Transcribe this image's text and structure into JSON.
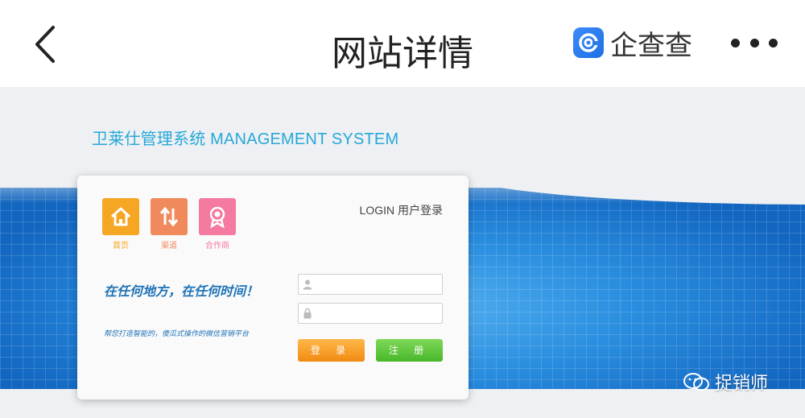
{
  "header": {
    "title": "网站详情",
    "brand_name": "企查查",
    "brand_color": "#2b7de9"
  },
  "website": {
    "system_title": "卫莱仕管理系统 MANAGEMENT SYSTEM",
    "nav_icons": [
      {
        "label": "首页",
        "icon": "home-icon",
        "color": "#f5a623"
      },
      {
        "label": "渠道",
        "icon": "transfer-icon",
        "color": "#f08a5d"
      },
      {
        "label": "合作商",
        "icon": "badge-icon",
        "color": "#f47aa0"
      }
    ],
    "login_heading": "LOGIN 用户登录",
    "slogan": "在任何地方，在任何时间！",
    "sub_slogan": "帮您打造智能的，傻瓜式操作的微信营销平台",
    "username_value": "",
    "password_value": "",
    "login_button": "登 录",
    "register_button": "注 册",
    "colors": {
      "accent_blue": "#1573c9",
      "login_orange": "#f08a12",
      "register_green": "#47b72a"
    }
  },
  "watermark": {
    "text": "捉销师"
  }
}
